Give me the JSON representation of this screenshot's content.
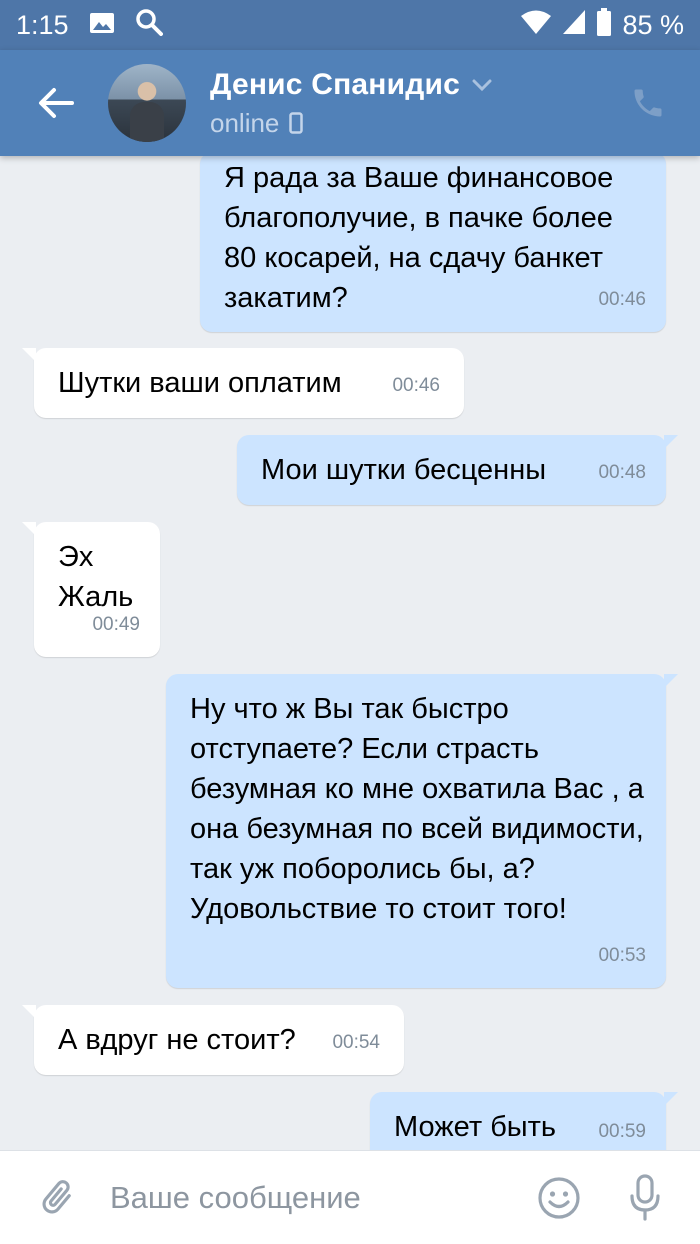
{
  "status_bar": {
    "time": "1:15",
    "battery": "85 %",
    "icons": [
      "image-icon",
      "search-icon",
      "wifi-icon",
      "signal-icon",
      "battery-icon"
    ]
  },
  "header": {
    "contact_name": "Денис Спанидис",
    "presence": "online",
    "icons": [
      "back-arrow-icon",
      "chevron-down-icon",
      "mobile-device-icon",
      "phone-icon"
    ]
  },
  "messages": [
    {
      "direction": "out",
      "text": "Я рада за Ваше финансовое благополучие, в пачке более 80 косарей, на сдачу банкет закатим?",
      "time": "00:46"
    },
    {
      "direction": "in",
      "text": "Шутки ваши оплатим",
      "time": "00:46"
    },
    {
      "direction": "out",
      "text": "Мои шутки бесценны",
      "time": "00:48"
    },
    {
      "direction": "in",
      "text": "Эх\nЖаль",
      "time": "00:49"
    },
    {
      "direction": "out",
      "text": "Ну что ж Вы так быстро отступаете? Если страсть безумная ко мне охватила Вас , а она безумная по всей видимости, так уж поборолись бы, а?  Удовольствие то стоит того!",
      "time": "00:53"
    },
    {
      "direction": "in",
      "text": "А вдруг не стоит?",
      "time": "00:54"
    },
    {
      "direction": "out",
      "text": "Может быть",
      "time": "00:59"
    }
  ],
  "composer": {
    "placeholder": "Ваше сообщение",
    "icons": [
      "paperclip-icon",
      "emoji-icon",
      "microphone-icon"
    ]
  },
  "colors": {
    "status_bar": "#4e76a8",
    "header": "#5181b8",
    "chat_background": "#ebeef2",
    "outgoing_bubble": "#cce4ff",
    "incoming_bubble": "#ffffff"
  }
}
